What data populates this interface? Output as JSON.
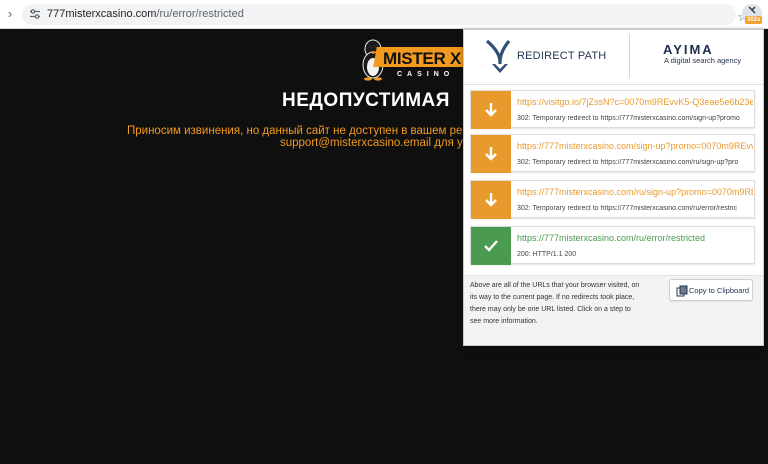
{
  "browser": {
    "url_host": "777misterxcasino.com",
    "url_path": "/ru/error/restricted",
    "extension_badge": "302s"
  },
  "page": {
    "logo_text": "MISTER X",
    "logo_sub": "CASINO",
    "title": "НЕДОПУСТИМАЯ",
    "message_line1": "Приносим извинения, но данный сайт не доступен в вашем рег",
    "message_line2": "support@misterxcasino.email для ут"
  },
  "popup": {
    "brand": "REDIRECT PATH",
    "partner": "AYIMA",
    "partner_tagline": "A digital search agency",
    "hops": [
      {
        "type": "redirect",
        "url": "https://visitgo.io/7jZssN?c=0070m9REvvK5-Q3eae5e6b23e8",
        "status": "302: Temporary redirect to https://777misterxcasino.com/sign-up?promo"
      },
      {
        "type": "redirect",
        "url": "https://777misterxcasino.com/sign-up?promo=0070m9REvvK",
        "status": "302: Temporary redirect to https://777misterxcasino.com/ru/sign-up?pro"
      },
      {
        "type": "redirect",
        "url": "https://777misterxcasino.com/ru/sign-up?promo=0070m9RE",
        "status": "302: Temporary redirect to https://777misterxcasino.com/ru/error/restric"
      },
      {
        "type": "ok",
        "url": "https://777misterxcasino.com/ru/error/restricted",
        "status": "200: HTTP/1.1 200"
      }
    ],
    "footer_text": "Above are all of the URLs that your browser visited, on its way to the current page. If no redirects took place, there may only be one URL listed. Click on a step to see more information.",
    "copy_label": "Copy to Clipboard"
  },
  "colors": {
    "redirect": "#e89a2c",
    "ok": "#4a9a4f",
    "brand_orange": "#f29a1e"
  },
  "icons": {
    "site_settings": "tune-icon",
    "bookmark": "star-icon",
    "extension": "redirect-path-icon",
    "redirect_step": "arrow-down-icon",
    "final_step": "check-icon",
    "copy": "clipboard-icon"
  }
}
